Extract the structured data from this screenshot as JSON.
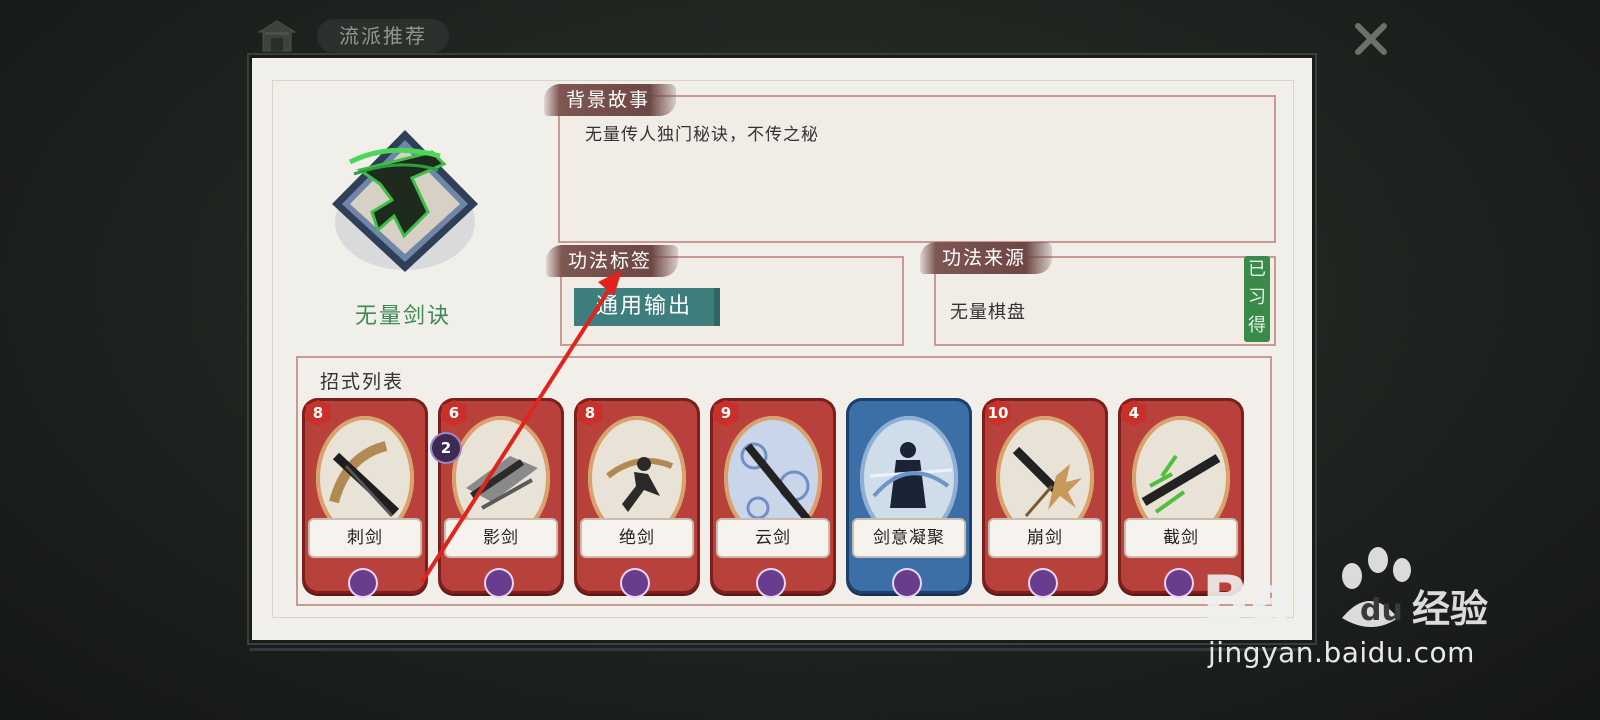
{
  "header": {
    "tab_label": "流派推荐"
  },
  "technique": {
    "name": "无量剑诀",
    "background_label": "背景故事",
    "background_text": "无量传人独门秘诀，不传之秘",
    "tags_label": "功法标签",
    "tag": "通用输出",
    "source_label": "功法来源",
    "source": "无量棋盘",
    "learned": "已习得"
  },
  "moves": {
    "title": "招式列表",
    "cards": [
      {
        "name": "刺剑",
        "cost": "8",
        "color": "red",
        "type_icon": "sword-icon"
      },
      {
        "name": "影剑",
        "cost": "6",
        "color": "red",
        "type_icon": "sword-icon",
        "badge": "2"
      },
      {
        "name": "绝剑",
        "cost": "8",
        "color": "red",
        "type_icon": "sword-icon"
      },
      {
        "name": "云剑",
        "cost": "9",
        "color": "red",
        "type_icon": "sword-icon"
      },
      {
        "name": "剑意凝聚",
        "cost": "",
        "color": "blue",
        "type_icon": "bell-icon"
      },
      {
        "name": "崩剑",
        "cost": "10",
        "color": "red",
        "type_icon": "sword-icon"
      },
      {
        "name": "截剑",
        "cost": "4",
        "color": "red",
        "type_icon": "sword-icon"
      }
    ]
  },
  "watermark": {
    "logo_text": "Baidu经验",
    "url": "jingyan.baidu.com"
  },
  "colors": {
    "panel": "#f1efea",
    "card_red": "#b8413c",
    "card_blue": "#3c6fa8",
    "accent_green": "#3f8a52",
    "tag_teal": "#3e7e7c",
    "annotation_arrow": "#e0241d"
  }
}
